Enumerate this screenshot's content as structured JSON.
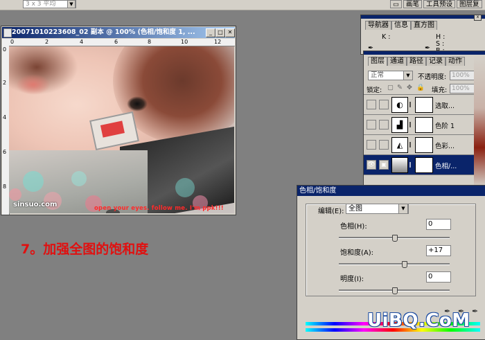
{
  "top": {
    "sample_select": "3 x 3 平均",
    "tabs": [
      "画笔",
      "工具预设",
      "图层复"
    ]
  },
  "image_window": {
    "title": "20071010223608_02 副本 @ 100% (色相/饱和度 1, ...",
    "ruler_top": [
      "0",
      "2",
      "4",
      "6",
      "8",
      "10",
      "12"
    ],
    "ruler_left": [
      "0",
      "2",
      "4",
      "6",
      "8"
    ],
    "watermark": "sinsuo.com",
    "caption": "open your eyes. follow me.  I'm ppk!!!"
  },
  "step_text": "7。加强全图的饱和度",
  "navigator": {
    "tabs": [
      "导航器",
      "信息",
      "直方图"
    ],
    "labels": [
      "K :",
      "H :",
      "S :",
      "B :"
    ]
  },
  "layers": {
    "tabs": [
      "图层",
      "通道",
      "路径",
      "记录",
      "动作"
    ],
    "blend_mode": "正常",
    "opacity_label": "不透明度:",
    "opacity_value": "100%",
    "lock_label": "锁定:",
    "fill_label": "填充:",
    "fill_value": "100%",
    "items": [
      {
        "name": "选取...",
        "icon": "◐"
      },
      {
        "name": "色阶 1",
        "icon": "▟"
      },
      {
        "name": "色彩...",
        "icon": "◭"
      },
      {
        "name": "色相/...",
        "icon": "▤"
      }
    ]
  },
  "hue_sat": {
    "title": "色相/饱和度",
    "edit_label": "编辑(E):",
    "edit_value": "全图",
    "hue_label": "色相(H):",
    "hue_value": "0",
    "saturation_label": "饱和度(A):",
    "saturation_value": "+17",
    "lightness_label": "明度(I):",
    "lightness_value": "0"
  },
  "site_watermark": "UiBQ.CoM"
}
